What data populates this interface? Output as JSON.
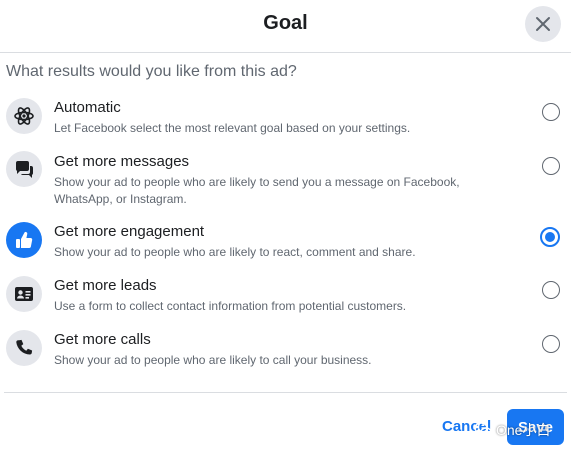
{
  "dialog": {
    "title": "Goal",
    "question": "What results would you like from this ad?"
  },
  "options": [
    {
      "title": "Automatic",
      "description": "Let Facebook select the most relevant goal based on your settings.",
      "icon": "atom-icon",
      "selected": false
    },
    {
      "title": "Get more messages",
      "description": "Show your ad to people who are likely to send you a message on Facebook, WhatsApp, or Instagram.",
      "icon": "chat-bubbles-icon",
      "selected": false
    },
    {
      "title": "Get more engagement",
      "description": "Show your ad to people who are likely to react, comment and share.",
      "icon": "thumbs-up-icon",
      "selected": true
    },
    {
      "title": "Get more leads",
      "description": "Use a form to collect contact information from potential customers.",
      "icon": "contact-card-icon",
      "selected": false
    },
    {
      "title": "Get more calls",
      "description": "Show your ad to people who are likely to call your business.",
      "icon": "phone-icon",
      "selected": false
    }
  ],
  "footer": {
    "cancel_label": "Cancel",
    "save_label": "Save"
  },
  "watermark": {
    "text": "One小白"
  },
  "colors": {
    "accent": "#1877f2",
    "icon_bg": "#e4e6eb",
    "secondary_text": "#606770"
  }
}
